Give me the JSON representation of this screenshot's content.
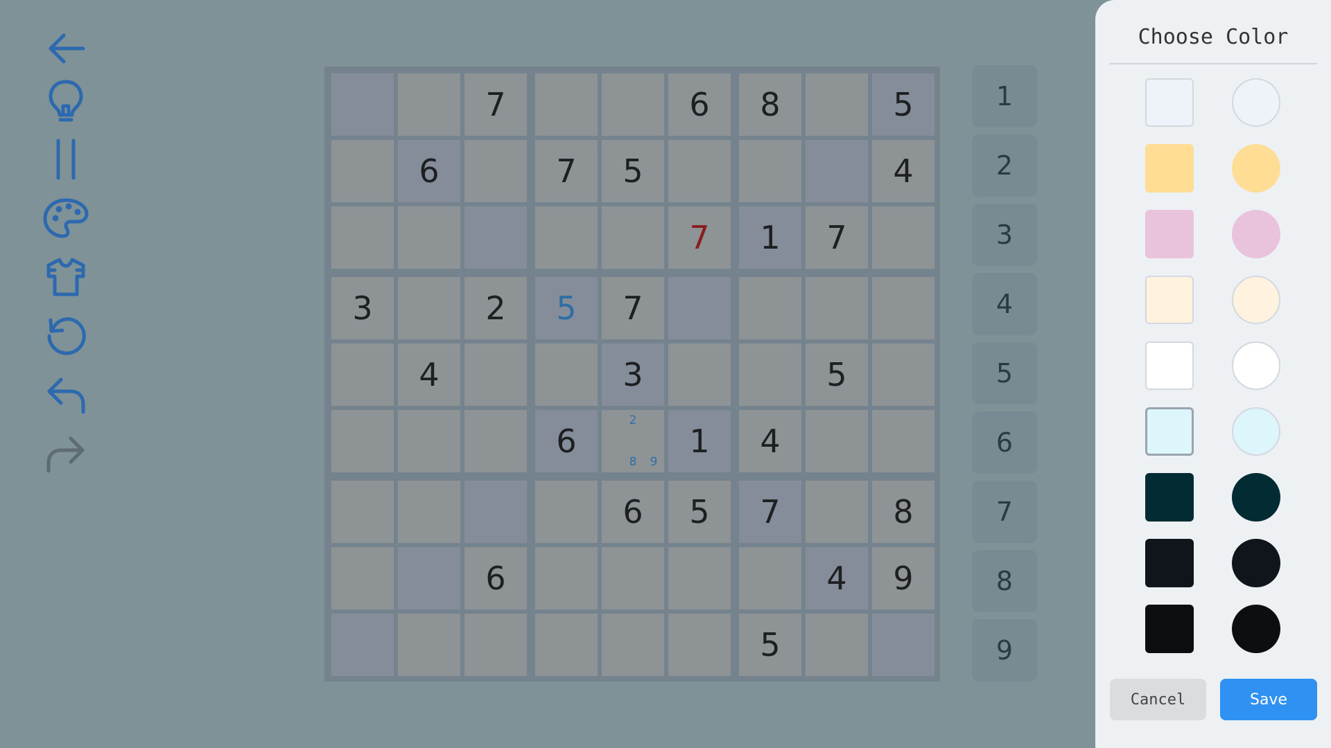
{
  "toolbar": {
    "icon_color": "#2c69ae",
    "redo_icon_color": "#5e6b73",
    "items": [
      {
        "name": "back-arrow-icon"
      },
      {
        "name": "lightbulb-icon"
      },
      {
        "name": "pause-icon"
      },
      {
        "name": "palette-icon"
      },
      {
        "name": "shirt-icon"
      },
      {
        "name": "restart-icon"
      },
      {
        "name": "undo-icon"
      },
      {
        "name": "redo-icon"
      }
    ]
  },
  "board": {
    "colors": {
      "cell": "#8e9496",
      "highlighted_cell": "#848d99",
      "grid_line": "#74838e",
      "given_digit": "#1d1f21",
      "error_digit": "#8a1d1d",
      "user_digit": "#2f6ea5"
    },
    "rows": [
      [
        "",
        "",
        "7",
        "",
        "",
        "6",
        "8",
        "",
        "5"
      ],
      [
        "",
        "6",
        "",
        "7",
        "5",
        "",
        "",
        "",
        "4"
      ],
      [
        "",
        "",
        "",
        "",
        "",
        "7",
        "1",
        "7",
        ""
      ],
      [
        "3",
        "",
        "2",
        "5",
        "7",
        "",
        "",
        "",
        ""
      ],
      [
        "",
        "4",
        "",
        "",
        "3",
        "",
        "",
        "5",
        ""
      ],
      [
        "",
        "",
        "",
        "6",
        "",
        "1",
        "4",
        "",
        ""
      ],
      [
        "",
        "",
        "",
        "",
        "6",
        "5",
        "7",
        "",
        "8"
      ],
      [
        "",
        "",
        "6",
        "",
        "",
        "",
        "",
        "4",
        "9"
      ],
      [
        "",
        "",
        "",
        "",
        "",
        "",
        "5",
        "",
        ""
      ]
    ],
    "highlighted": [
      [
        0,
        0
      ],
      [
        0,
        8
      ],
      [
        1,
        1
      ],
      [
        1,
        7
      ],
      [
        2,
        2
      ],
      [
        2,
        6
      ],
      [
        3,
        3
      ],
      [
        3,
        5
      ],
      [
        4,
        4
      ],
      [
        5,
        3
      ],
      [
        5,
        5
      ],
      [
        6,
        2
      ],
      [
        6,
        6
      ],
      [
        7,
        1
      ],
      [
        7,
        7
      ],
      [
        8,
        0
      ],
      [
        8,
        8
      ]
    ],
    "error_cells": [
      [
        2,
        5
      ]
    ],
    "user_cells": [
      [
        3,
        3
      ]
    ],
    "note_cells": [
      {
        "row": 5,
        "col": 4,
        "notes": [
          "",
          "2",
          "",
          "",
          "",
          "",
          "",
          "8",
          "9"
        ]
      }
    ]
  },
  "numpad": [
    "1",
    "2",
    "3",
    "4",
    "5",
    "6",
    "7",
    "8",
    "9"
  ],
  "color_panel": {
    "title": "Choose Color",
    "selected_index": 5,
    "swatches": [
      {
        "color": "#eef3fa",
        "light": true
      },
      {
        "color": "#ffdd95",
        "light": false
      },
      {
        "color": "#e9c3dc",
        "light": false
      },
      {
        "color": "#fff3e0",
        "light": true
      },
      {
        "color": "#ffffff",
        "light": true
      },
      {
        "color": "#dcf6fc",
        "light": true
      },
      {
        "color": "#022b33",
        "light": false
      },
      {
        "color": "#10151c",
        "light": false
      },
      {
        "color": "#0c0f12",
        "light": false
      }
    ],
    "cancel_label": "Cancel",
    "save_label": "Save"
  }
}
